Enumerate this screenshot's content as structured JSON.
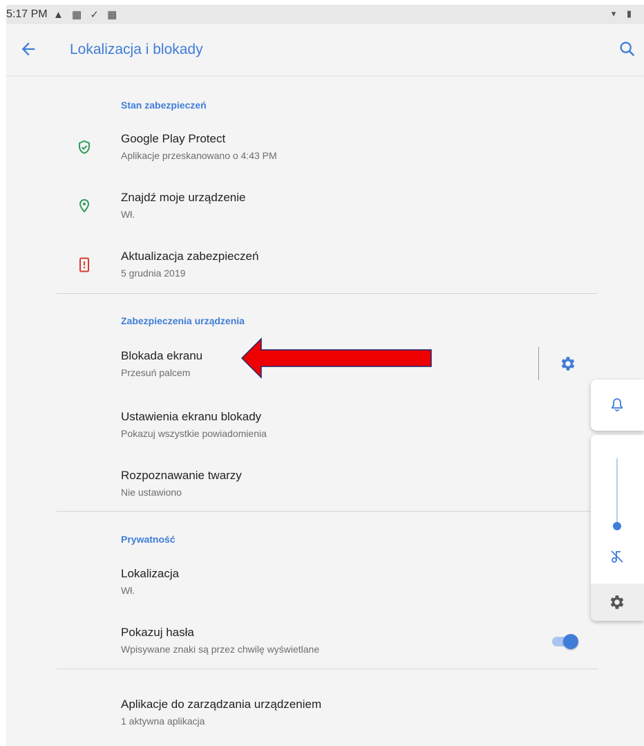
{
  "status_bar": {
    "time": "5:17 PM",
    "left_icons": [
      "warning-icon",
      "notification-icon",
      "check-icon",
      "notification-icon"
    ],
    "right_icons": [
      "wifi-icon",
      "battery-icon"
    ]
  },
  "app_bar": {
    "title": "Lokalizacja i blokady",
    "back_icon": "back-arrow-icon",
    "search_icon": "search-icon"
  },
  "sections": {
    "security_status": {
      "title": "Stan zabezpieczeń",
      "items": [
        {
          "title": "Google Play Protect",
          "subtitle": "Aplikacje przeskanowano o 4:43 PM",
          "icon": "shield-check-icon",
          "icon_color": "#2e9d5b"
        },
        {
          "title": "Znajdź moje urządzenie",
          "subtitle": "Wł.",
          "icon": "location-pin-icon",
          "icon_color": "#2e9d5b"
        },
        {
          "title": "Aktualizacja zabezpieczeń",
          "subtitle": "5 grudnia 2019",
          "icon": "phone-alert-icon",
          "icon_color": "#d93b30"
        }
      ]
    },
    "device_security": {
      "title": "Zabezpieczenia urządzenia",
      "items": [
        {
          "title": "Blokada ekranu",
          "subtitle": "Przesuń palcem",
          "action_icon": "gear-icon"
        },
        {
          "title": "Ustawienia ekranu blokady",
          "subtitle": "Pokazuj wszystkie powiadomienia"
        },
        {
          "title": "Rozpoznawanie twarzy",
          "subtitle": "Nie ustawiono"
        }
      ]
    },
    "privacy": {
      "title": "Prywatność",
      "items": [
        {
          "title": "Lokalizacja",
          "subtitle": "Wł."
        },
        {
          "title": "Pokazuj hasła",
          "subtitle": "Wpisywane znaki są przez chwilę wyświetlane",
          "toggle_on": true
        }
      ]
    },
    "admin": {
      "items": [
        {
          "title": "Aplikacje do zarządzania urządzeniem",
          "subtitle": "1 aktywna aplikacja"
        }
      ]
    }
  },
  "annotation": {
    "type": "red-arrow",
    "color": "#ee0000",
    "points_to": "Blokada ekranu"
  },
  "volume_panel": {
    "ringer_icon": "bell-icon",
    "muted_icon": "music-off-icon",
    "settings_icon": "gear-icon",
    "level": 0.1
  },
  "colors": {
    "accent": "#3f7dd8",
    "green": "#2e9d5b",
    "red": "#d93b30",
    "background": "#f4f4f4"
  }
}
